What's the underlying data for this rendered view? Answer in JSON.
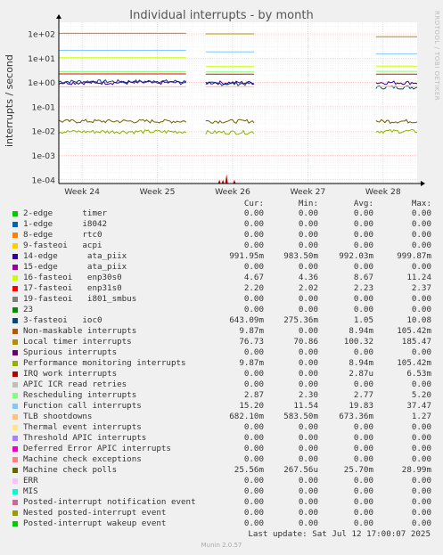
{
  "title": "Individual interrupts - by month",
  "ylabel": "interrupts / second",
  "watermark": "RRDTOOL / TOBI OETIKER",
  "headers": {
    "cur": "Cur:",
    "min": "Min:",
    "avg": "Avg:",
    "max": "Max:"
  },
  "legend": [
    {
      "name": "2-edge      timer",
      "color": "#00cc00",
      "cur": "0.00",
      "min": "0.00",
      "avg": "0.00",
      "max": "0.00"
    },
    {
      "name": "1-edge      i8042",
      "color": "#0066b3",
      "cur": "0.00",
      "min": "0.00",
      "avg": "0.00",
      "max": "0.00"
    },
    {
      "name": "8-edge      rtc0",
      "color": "#ff8000",
      "cur": "0.00",
      "min": "0.00",
      "avg": "0.00",
      "max": "0.00"
    },
    {
      "name": "9-fasteoi   acpi",
      "color": "#ffcc00",
      "cur": "0.00",
      "min": "0.00",
      "avg": "0.00",
      "max": "0.00"
    },
    {
      "name": "14-edge      ata_piix",
      "color": "#330099",
      "cur": "991.95m",
      "min": "983.50m",
      "avg": "992.03m",
      "max": "999.87m"
    },
    {
      "name": "15-edge      ata_piix",
      "color": "#990099",
      "cur": "0.00",
      "min": "0.00",
      "avg": "0.00",
      "max": "0.00"
    },
    {
      "name": "16-fasteoi   enp30s0",
      "color": "#ccff00",
      "cur": "4.67",
      "min": "4.36",
      "avg": "8.67",
      "max": "11.24"
    },
    {
      "name": "17-fasteoi   enp31s0",
      "color": "#ff0000",
      "cur": "2.20",
      "min": "2.02",
      "avg": "2.23",
      "max": "2.37"
    },
    {
      "name": "19-fasteoi   i801_smbus",
      "color": "#808080",
      "cur": "0.00",
      "min": "0.00",
      "avg": "0.00",
      "max": "0.00"
    },
    {
      "name": "23",
      "color": "#008f00",
      "cur": "0.00",
      "min": "0.00",
      "avg": "0.00",
      "max": "0.00"
    },
    {
      "name": "3-fasteoi   ioc0",
      "color": "#00487d",
      "cur": "643.09m",
      "min": "275.36m",
      "avg": "1.05",
      "max": "10.08"
    },
    {
      "name": "Non-maskable interrupts",
      "color": "#b35a00",
      "cur": "9.87m",
      "min": "0.00",
      "avg": "8.94m",
      "max": "105.42m"
    },
    {
      "name": "Local timer interrupts",
      "color": "#b38f00",
      "cur": "76.73",
      "min": "70.86",
      "avg": "100.32",
      "max": "185.47"
    },
    {
      "name": "Spurious interrupts",
      "color": "#6b006b",
      "cur": "0.00",
      "min": "0.00",
      "avg": "0.00",
      "max": "0.00"
    },
    {
      "name": "Performance monitoring interrupts",
      "color": "#8fb300",
      "cur": "9.87m",
      "min": "0.00",
      "avg": "8.94m",
      "max": "105.42m"
    },
    {
      "name": "IRQ work interrupts",
      "color": "#b30000",
      "cur": "0.00",
      "min": "0.00",
      "avg": "2.87u",
      "max": "6.53m"
    },
    {
      "name": "APIC ICR read retries",
      "color": "#bebebe",
      "cur": "0.00",
      "min": "0.00",
      "avg": "0.00",
      "max": "0.00"
    },
    {
      "name": "Rescheduling interrupts",
      "color": "#80ff80",
      "cur": "2.87",
      "min": "2.30",
      "avg": "2.77",
      "max": "5.20"
    },
    {
      "name": "Function call interrupts",
      "color": "#80c9ff",
      "cur": "15.20",
      "min": "11.54",
      "avg": "19.83",
      "max": "37.47"
    },
    {
      "name": "TLB shootdowns",
      "color": "#ffc080",
      "cur": "682.10m",
      "min": "583.50m",
      "avg": "673.36m",
      "max": "1.27"
    },
    {
      "name": "Thermal event interrupts",
      "color": "#ffe680",
      "cur": "0.00",
      "min": "0.00",
      "avg": "0.00",
      "max": "0.00"
    },
    {
      "name": "Threshold APIC interrupts",
      "color": "#aa80ff",
      "cur": "0.00",
      "min": "0.00",
      "avg": "0.00",
      "max": "0.00"
    },
    {
      "name": "Deferred Error APIC interrupts",
      "color": "#ee00cc",
      "cur": "0.00",
      "min": "0.00",
      "avg": "0.00",
      "max": "0.00"
    },
    {
      "name": "Machine check exceptions",
      "color": "#ff8080",
      "cur": "0.00",
      "min": "0.00",
      "avg": "0.00",
      "max": "0.00"
    },
    {
      "name": "Machine check polls",
      "color": "#666600",
      "cur": "25.56m",
      "min": "267.56u",
      "avg": "25.70m",
      "max": "28.99m"
    },
    {
      "name": "ERR",
      "color": "#ffbfff",
      "cur": "0.00",
      "min": "0.00",
      "avg": "0.00",
      "max": "0.00"
    },
    {
      "name": "MIS",
      "color": "#00ffcc",
      "cur": "0.00",
      "min": "0.00",
      "avg": "0.00",
      "max": "0.00"
    },
    {
      "name": "Posted-interrupt notification event",
      "color": "#cc6699",
      "cur": "0.00",
      "min": "0.00",
      "avg": "0.00",
      "max": "0.00"
    },
    {
      "name": "Nested posted-interrupt event",
      "color": "#999900",
      "cur": "0.00",
      "min": "0.00",
      "avg": "0.00",
      "max": "0.00"
    },
    {
      "name": "Posted-interrupt wakeup event",
      "color": "#00cc00",
      "cur": "0.00",
      "min": "0.00",
      "avg": "0.00",
      "max": "0.00"
    }
  ],
  "last_update": "Last update: Sat Jul 12 17:00:07 2025",
  "munin_version": "Munin 2.0.57",
  "chart_data": {
    "type": "line",
    "title": "Individual interrupts - by month",
    "ylabel": "interrupts / second",
    "yscale": "log",
    "ylim": [
      7e-05,
      300
    ],
    "y_ticks": [
      "1e-04",
      "1e-03",
      "1e-02",
      "1e-01",
      "1e+00",
      "1e+01",
      "1e+02"
    ],
    "x_ticks": [
      "Week 24",
      "Week 25",
      "Week 26",
      "Week 27",
      "Week 28"
    ],
    "grid": true,
    "segments": [
      [
        0,
        0.355
      ],
      [
        0.41,
        0.545
      ],
      [
        0.885,
        1.0
      ]
    ],
    "series": [
      {
        "name": "Local timer interrupts",
        "color": "#b38f00",
        "values": [
          105,
          100,
          76.73
        ]
      },
      {
        "name": "Function call interrupts",
        "color": "#80c9ff",
        "values": [
          21,
          18,
          15.2
        ]
      },
      {
        "name": "16-fasteoi   enp30s0",
        "color": "#ccff00",
        "values": [
          10.5,
          4.5,
          4.67
        ]
      },
      {
        "name": "Rescheduling interrupts",
        "color": "#80ff80",
        "values": [
          2.8,
          2.7,
          2.87
        ]
      },
      {
        "name": "17-fasteoi   enp31s0",
        "color": "#ff0000",
        "values": [
          2.25,
          2.2,
          2.2
        ]
      },
      {
        "name": "3-fasteoi   ioc0",
        "color": "#00487d",
        "values": [
          1.1,
          0.9,
          0.643
        ]
      },
      {
        "name": "14-edge      ata_piix",
        "color": "#330099",
        "values": [
          0.992,
          0.99,
          0.992
        ]
      },
      {
        "name": "TLB shootdowns",
        "color": "#ffc080",
        "values": [
          0.67,
          0.68,
          0.682
        ]
      },
      {
        "name": "Machine check polls",
        "color": "#666600",
        "values": [
          0.0257,
          0.0256,
          0.0256
        ]
      },
      {
        "name": "Performance monitoring interrupts",
        "color": "#8fb300",
        "values": [
          0.0095,
          0.009,
          0.0099
        ]
      },
      {
        "name": "IRQ work interrupts",
        "color": "#b30000",
        "spikes": [
          0.0001,
          0.0001,
          0.00017,
          0.0001
        ]
      }
    ]
  }
}
